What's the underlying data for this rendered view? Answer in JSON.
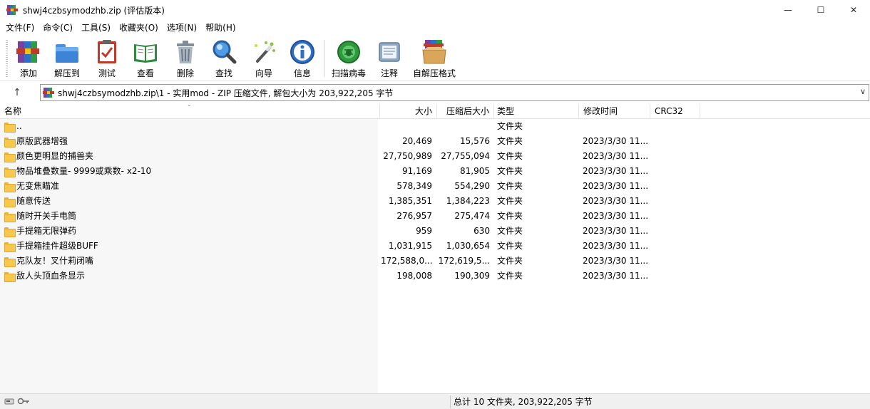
{
  "window": {
    "title": "shwj4czbsymodzhb.zip (评估版本)",
    "minimize_glyph": "—",
    "maximize_glyph": "☐",
    "close_glyph": "✕"
  },
  "menu": [
    "文件(F)",
    "命令(C)",
    "工具(S)",
    "收藏夹(O)",
    "选项(N)",
    "帮助(H)"
  ],
  "toolbar": {
    "add": "添加",
    "extract_to": "解压到",
    "test": "测试",
    "view": "查看",
    "delete": "删除",
    "find": "查找",
    "wizard": "向导",
    "info": "信息",
    "virus_scan": "扫描病毒",
    "comment": "注释",
    "sfx": "自解压格式"
  },
  "address": {
    "up_glyph": "↑",
    "path": "shwj4czbsymodzhb.zip\\1 - 实用mod - ZIP 压缩文件, 解包大小为 203,922,205 字节",
    "dropdown_glyph": "∨"
  },
  "columns": {
    "name": "名称",
    "size": "大小",
    "packed": "压缩后大小",
    "type": "类型",
    "modified": "修改时间",
    "crc": "CRC32"
  },
  "rows": [
    {
      "name": "..",
      "size": "",
      "packed": "",
      "type": "文件夹",
      "modified": ""
    },
    {
      "name": "原版武器增强",
      "size": "20,469",
      "packed": "15,576",
      "type": "文件夹",
      "modified": "2023/3/30 11..."
    },
    {
      "name": "颜色更明显的捕兽夹",
      "size": "27,750,989",
      "packed": "27,755,094",
      "type": "文件夹",
      "modified": "2023/3/30 11..."
    },
    {
      "name": "物品堆叠数量- 9999或乘数- x2-10",
      "size": "91,169",
      "packed": "81,905",
      "type": "文件夹",
      "modified": "2023/3/30 11..."
    },
    {
      "name": "无变焦瞄准",
      "size": "578,349",
      "packed": "554,290",
      "type": "文件夹",
      "modified": "2023/3/30 11..."
    },
    {
      "name": "随意传送",
      "size": "1,385,351",
      "packed": "1,384,223",
      "type": "文件夹",
      "modified": "2023/3/30 11..."
    },
    {
      "name": "随时开关手电筒",
      "size": "276,957",
      "packed": "275,474",
      "type": "文件夹",
      "modified": "2023/3/30 11..."
    },
    {
      "name": "手提箱无限弹药",
      "size": "959",
      "packed": "630",
      "type": "文件夹",
      "modified": "2023/3/30 11..."
    },
    {
      "name": "手提箱挂件超级BUFF",
      "size": "1,031,915",
      "packed": "1,030,654",
      "type": "文件夹",
      "modified": "2023/3/30 11..."
    },
    {
      "name": "克队友！叉什莉闭嘴",
      "size": "172,588,0...",
      "packed": "172,619,5...",
      "type": "文件夹",
      "modified": "2023/3/30 11..."
    },
    {
      "name": "敌人头顶血条显示",
      "size": "198,008",
      "packed": "190,309",
      "type": "文件夹",
      "modified": "2023/3/30 11..."
    }
  ],
  "status": {
    "summary": "总计 10 文件夹, 203,922,205 字节"
  }
}
